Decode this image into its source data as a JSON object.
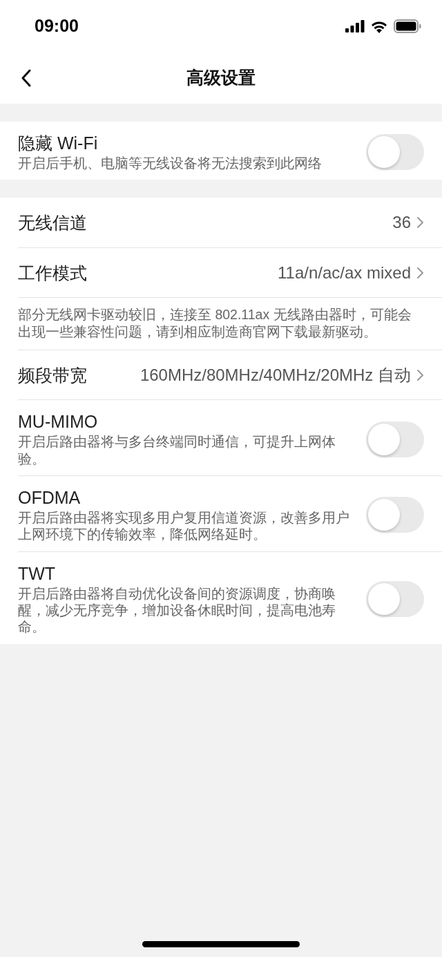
{
  "status_bar": {
    "time": "09:00"
  },
  "nav": {
    "title": "高级设置"
  },
  "sections": [
    {
      "rows": [
        {
          "kind": "toggle",
          "title": "隐藏 Wi-Fi",
          "subtitle": "开启后手机、电脑等无线设备将无法搜索到此网络",
          "on": false
        }
      ]
    },
    {
      "rows": [
        {
          "kind": "link",
          "title": "无线信道",
          "value": "36"
        },
        {
          "kind": "link",
          "title": "工作模式",
          "value": "11a/n/ac/ax mixed"
        },
        {
          "kind": "note",
          "text": "部分无线网卡驱动较旧，连接至 802.11ax 无线路由器时，可能会出现一些兼容性问题，请到相应制造商官网下载最新驱动。"
        },
        {
          "kind": "link",
          "title": "频段带宽",
          "value": "160MHz/80MHz/40MHz/20MHz 自动"
        },
        {
          "kind": "toggle",
          "title": "MU-MIMO",
          "subtitle": "开启后路由器将与多台终端同时通信，可提升上网体验。",
          "on": false
        },
        {
          "kind": "toggle",
          "title": "OFDMA",
          "subtitle": "开启后路由器将实现多用户复用信道资源，改善多用户上网环境下的传输效率，降低网络延时。",
          "on": false
        },
        {
          "kind": "toggle",
          "title": "TWT",
          "subtitle": "开启后路由器将自动优化设备间的资源调度，协商唤醒，减少无序竞争，增加设备休眠时间，提高电池寿命。",
          "on": false
        }
      ]
    }
  ]
}
